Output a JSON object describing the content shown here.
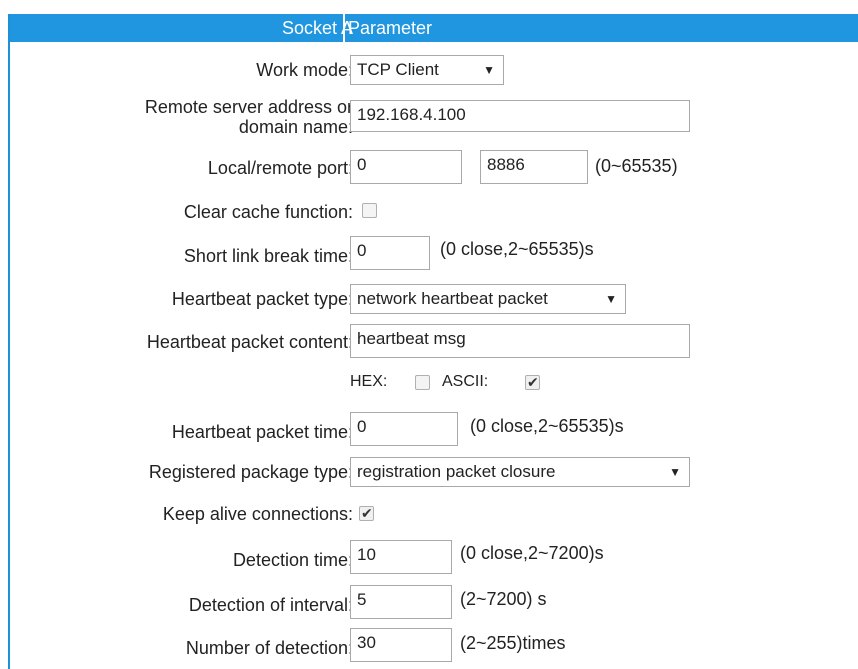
{
  "header": {
    "left": "Socket A",
    "right": "Parameter"
  },
  "work_mode": {
    "label": "Work mode:",
    "value": "TCP Client",
    "arrow": "▼"
  },
  "remote_server": {
    "label_line1": "Remote server address or",
    "label_line2": "domain name:",
    "value": "192.168.4.100"
  },
  "ports": {
    "label": "Local/remote port:",
    "local": "0",
    "remote": "8886",
    "hint": "(0~65535)"
  },
  "clear_cache": {
    "label": "Clear cache function:",
    "checked": false
  },
  "short_link": {
    "label": "Short link break time:",
    "value": "0",
    "hint": "(0 close,2~65535)s"
  },
  "heartbeat_type": {
    "label": "Heartbeat packet type:",
    "value": "network heartbeat packet",
    "arrow": "▼"
  },
  "heartbeat_content": {
    "label": "Heartbeat packet content:",
    "value": "heartbeat msg"
  },
  "encoding": {
    "hex_label": "HEX:",
    "hex_checked": false,
    "ascii_label": "ASCII:",
    "ascii_checked": true,
    "check_mark": "✔"
  },
  "heartbeat_time": {
    "label": "Heartbeat packet time:",
    "value": "0",
    "hint": "(0 close,2~65535)s"
  },
  "registered_type": {
    "label": "Registered package type:",
    "value": "registration packet closure",
    "arrow": "▼"
  },
  "keep_alive": {
    "label": "Keep alive connections:",
    "checked": true,
    "check_mark": "✔"
  },
  "detection_time": {
    "label": "Detection time:",
    "value": "10",
    "hint": "(0 close,2~7200)s"
  },
  "detection_interval": {
    "label": "Detection of interval:",
    "value": "5",
    "hint": "(2~7200) s"
  },
  "detection_count": {
    "label": "Number of detection:",
    "value": "30",
    "hint": "(2~255)times"
  }
}
